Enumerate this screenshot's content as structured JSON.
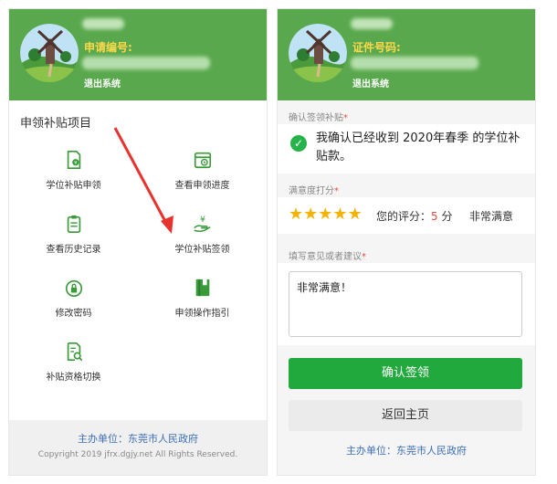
{
  "left": {
    "header": {
      "id_label": "申请编号:",
      "logout": "退出系统"
    },
    "menu_title": "申领补贴项目",
    "menu": [
      {
        "label": "学位补贴申领",
        "icon": "document-yen-icon"
      },
      {
        "label": "查看申领进度",
        "icon": "calendar-clock-icon"
      },
      {
        "label": "查看历史记录",
        "icon": "clipboard-list-icon"
      },
      {
        "label": "学位补贴签领",
        "icon": "hand-yen-icon"
      },
      {
        "label": "修改密码",
        "icon": "lock-icon"
      },
      {
        "label": "申领操作指引",
        "icon": "book-icon"
      },
      {
        "label": "补贴资格切换",
        "icon": "document-search-icon"
      }
    ],
    "footer": {
      "org": "主办单位：东莞市人民政府",
      "copyright": "Copyright 2019 jfrx.dgjy.net All Rights Reserved."
    }
  },
  "right": {
    "header": {
      "id_label": "证件号码:",
      "logout": "退出系统"
    },
    "confirm": {
      "label": "确认签领补贴",
      "text": "我确认已经收到 2020年春季 的学位补贴款。"
    },
    "satisfaction": {
      "label": "满意度打分",
      "stars": 5,
      "score_prefix": "您的评分：",
      "score_value": "5",
      "score_suffix": "分",
      "rating_text": "非常满意"
    },
    "feedback": {
      "label": "填写意见或者建议",
      "value": "非常满意！"
    },
    "buttons": {
      "confirm": "确认签领",
      "home": "返回主页"
    },
    "footer": {
      "org": "主办单位：东莞市人民政府"
    }
  },
  "colors": {
    "header_green": "#59a84d",
    "accent_green": "#22a93d",
    "id_label_yellow": "#ffd84a",
    "arrow_red": "#e8322e"
  }
}
